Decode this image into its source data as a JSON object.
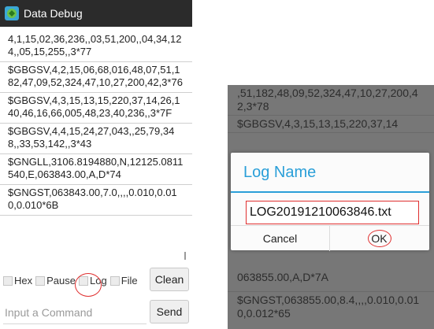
{
  "left": {
    "window_title": "Data Debug",
    "log_lines": [
      "4,1,15,02,36,236,,03,51,200,,04,34,124,,05,15,255,,3*77",
      "$GBGSV,4,2,15,06,68,016,48,07,51,182,47,09,52,324,47,10,27,200,42,3*76",
      "$GBGSV,4,3,15,13,15,220,37,14,26,140,46,16,66,005,48,23,40,236,,3*7F",
      "$GBGSV,4,4,15,24,27,043,,25,79,348,,33,53,142,,3*43",
      "$GNGLL,3106.8194880,N,12125.0811540,E,063843.00,A,D*74",
      "$GNGST,063843.00,7.0,,,,0.010,0.010,0.010*6B"
    ],
    "checkboxes": [
      "Hex",
      "Pause",
      "Log",
      "File"
    ],
    "clean_label": "Clean",
    "command_placeholder": "Input a Command",
    "send_label": "Send"
  },
  "right": {
    "log_lines_top": [
      ",51,182,48,09,52,324,47,10,27,200,42,3*78",
      "$GBGSV,4,3,15,13,15,220,37,14"
    ],
    "log_lines_bottom": [
      "063855.00,A,D*7A",
      "$GNGST,063855.00,8.4,,,,0.010,0.010,0.012*65"
    ],
    "dialog": {
      "title": "Log Name",
      "filename": "LOG20191210063846.txt",
      "cancel_label": "Cancel",
      "ok_label": "OK"
    }
  },
  "colors": {
    "titlebar": "#2b2b2b",
    "dialog_accent": "#2a9fd8",
    "annotation": "#e03030",
    "overlay": "#777777"
  }
}
